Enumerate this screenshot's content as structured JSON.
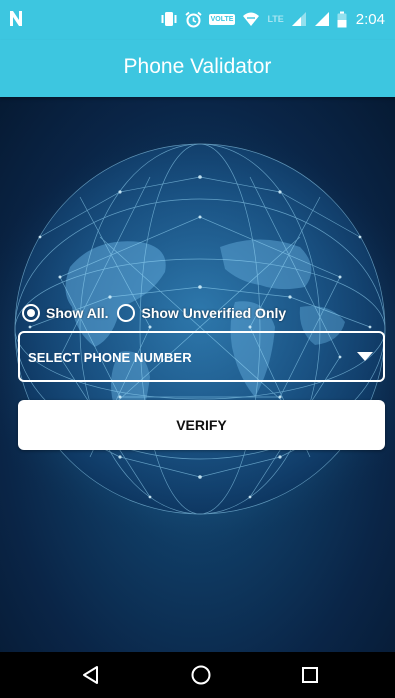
{
  "status_bar": {
    "volte_label": "VOLTE",
    "lte_label": "LTE",
    "time": "2:04",
    "icons": [
      "n-notification-icon",
      "vibrate-icon",
      "alarm-icon",
      "volte-icon",
      "wifi-icon",
      "signal-icon",
      "signal-icon",
      "battery-icon"
    ]
  },
  "app_bar": {
    "title": "Phone Validator",
    "color": "#3dc6e0"
  },
  "filter": {
    "option_all": "Show All.",
    "option_unverified": "Show Unverified Only",
    "selected": "Show All."
  },
  "phone_select": {
    "value": "SELECT PHONE NUMBER"
  },
  "verify_button": {
    "label": "VERIFY"
  },
  "nav_bar": {
    "icons": [
      "back-icon",
      "home-icon",
      "recents-icon"
    ]
  }
}
